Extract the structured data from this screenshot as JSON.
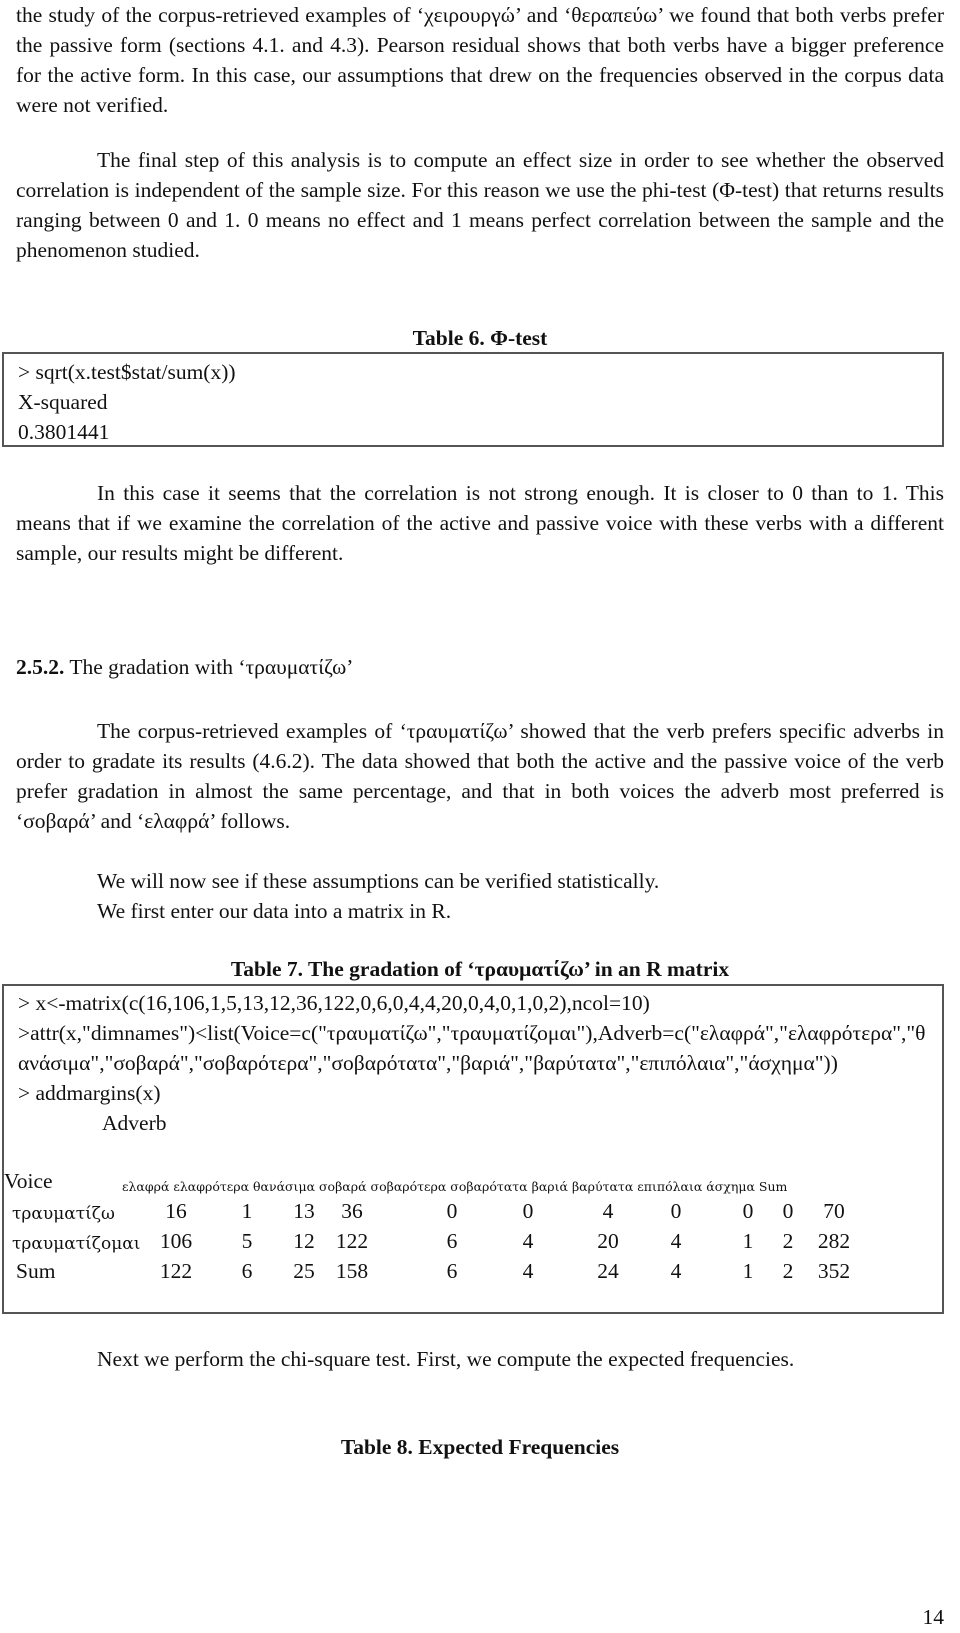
{
  "paragraphs": {
    "p1": "the study of the corpus-retrieved examples of ‘χειρουργώ’ and ‘θεραπεύω’ we found that both verbs prefer the passive form (sections 4.1. and 4.3). Pearson residual shows that both verbs have a bigger preference for the active form. In this case, our assumptions that drew on the frequencies observed in the corpus data were not verified.",
    "p2": "The final step of this analysis is to compute an effect size in order to see whether the observed correlation is independent of the sample size. For this reason we use the phi-test (Φ-test) that returns results ranging between 0 and 1. 0 means no effect and 1 means perfect correlation between the sample and the phenomenon studied.",
    "p3": "In this case it seems that the correlation is not strong enough. It is closer to 0 than to 1. This means that if we examine the correlation of the active and passive voice with these verbs with a different sample, our results might be different.",
    "p4": "The corpus-retrieved examples of ‘τραυματίζω’ showed that the verb prefers specific adverbs in order to gradate its results (4.6.2). The data showed that both the active and the passive voice of the verb prefer gradation in almost the same percentage, and that in both voices the adverb most preferred is ‘σοβαρά’ and ‘ελαφρά’ follows.",
    "p5": "We will now see if these assumptions can be verified statistically.",
    "p6": "We first enter our data into a matrix in R.",
    "p7": "Next we perform the chi-square test. First, we compute the expected frequencies."
  },
  "table6": {
    "caption": "Table 6. Φ-test",
    "lines": [
      "> sqrt(x.test$stat/sum(x))",
      "X-squared",
      "0.3801441"
    ]
  },
  "section": {
    "number": "2.5.2.",
    "title": " The gradation with ‘τραυματίζω’"
  },
  "table7": {
    "caption": "Table 7. The gradation of ‘τραυματίζω’ in an R matrix",
    "code": [
      "> x<-matrix(c(16,106,1,5,13,12,36,122,0,6,0,4,4,20,0,4,0,1,0,2),ncol=10)",
      ">attr(x,\"dimnames\")<list(Voice=c(\"τραυματίζω\",\"τραυματίζομαι\"),Adverb=c(\"ελαφρά\",\"ελαφρότερα\",\"θανάσιμα\",\"σοβαρά\",\"σοβαρότερα\",\"σοβαρότατα\",\"βαριά\",\"βαρύτατα\",\"επιπόλαια\",\"άσχημα\"))",
      "> addmargins(x)"
    ],
    "col_dim_label": "Adverb",
    "row_dim_label": "Voice",
    "columns": [
      "ελαφρά",
      "ελαφρότερα",
      "θανάσιμα",
      "σοβαρά",
      "σοβαρότερα",
      "σοβαρότατα",
      "βαριά",
      "βαρύτατα",
      "επιπόλαια",
      "άσχημα",
      "Sum"
    ],
    "rows": [
      {
        "label": "τραυματίζω",
        "values": [
          "16",
          "1",
          "13",
          "36",
          "0",
          "0",
          "4",
          "0",
          "0",
          "0",
          "70"
        ]
      },
      {
        "label": "τραυματίζομαι",
        "values": [
          "106",
          "5",
          "12",
          "122",
          "6",
          "4",
          "20",
          "4",
          "1",
          "2",
          "282"
        ]
      },
      {
        "label": "Sum",
        "values": [
          "122",
          "6",
          "25",
          "158",
          "6",
          "4",
          "24",
          "4",
          "1",
          "2",
          "352"
        ]
      }
    ]
  },
  "table8": {
    "caption": "Table 8. Expected Frequencies"
  },
  "page_number": "14"
}
